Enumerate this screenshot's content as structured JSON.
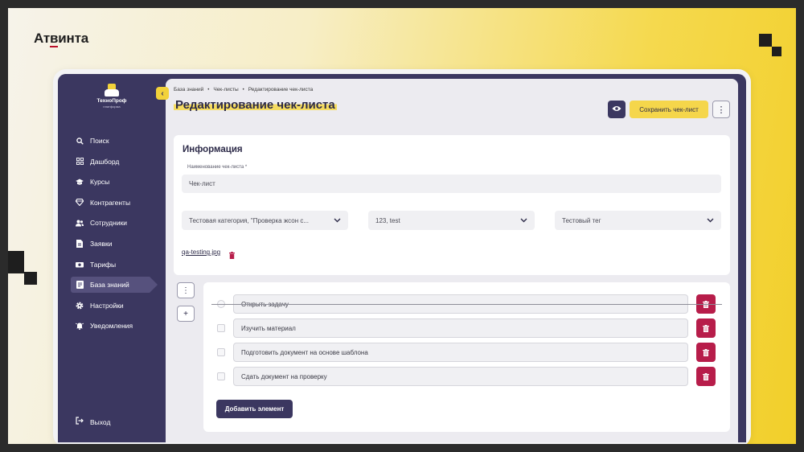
{
  "brand": {
    "name_part1": "Ат",
    "name_part2": "в",
    "name_part3": "инта"
  },
  "logo": {
    "title": "ТехноПроф",
    "subtitle": "платформа"
  },
  "sidebar": {
    "items": [
      {
        "label": "Поиск",
        "icon": "search-icon"
      },
      {
        "label": "Дашборд",
        "icon": "dashboard-icon"
      },
      {
        "label": "Курсы",
        "icon": "graduation-cap-icon"
      },
      {
        "label": "Контрагенты",
        "icon": "diamond-icon"
      },
      {
        "label": "Сотрудники",
        "icon": "users-icon"
      },
      {
        "label": "Заявки",
        "icon": "document-icon"
      },
      {
        "label": "Тарифы",
        "icon": "money-icon"
      },
      {
        "label": "База знаний",
        "icon": "book-icon",
        "active": true
      },
      {
        "label": "Настройки",
        "icon": "gear-icon"
      },
      {
        "label": "Уведомления",
        "icon": "bell-icon"
      }
    ],
    "logout": "Выход"
  },
  "header": {
    "breadcrumbs": [
      "База знаний",
      "Чек-листы",
      "Редактирование чек-листа"
    ],
    "title": "Редактирование чек-листа",
    "save_label": "Сохранить чек-лист"
  },
  "info": {
    "title": "Информация",
    "name_label": "Наименование чек-листа *",
    "name_value": "Чек-лист",
    "category_value": "Тестовая категория, \"Проверка жсон с...",
    "second_select_value": "123, test",
    "tag_value": "Тестовый тег",
    "file_name": "qa-testing.jpg"
  },
  "checklist": {
    "items": [
      {
        "text": "Открыть задачу",
        "dragging": true
      },
      {
        "text": "Изучить материал"
      },
      {
        "text": "Подготовить документ на основе шаблона"
      },
      {
        "text": "Сдать документ на проверку"
      }
    ],
    "add_label": "Добавить элемент"
  },
  "colors": {
    "sidebar": "#3b3760",
    "accent_yellow": "#f5d64b",
    "danger": "#b71d4a"
  }
}
